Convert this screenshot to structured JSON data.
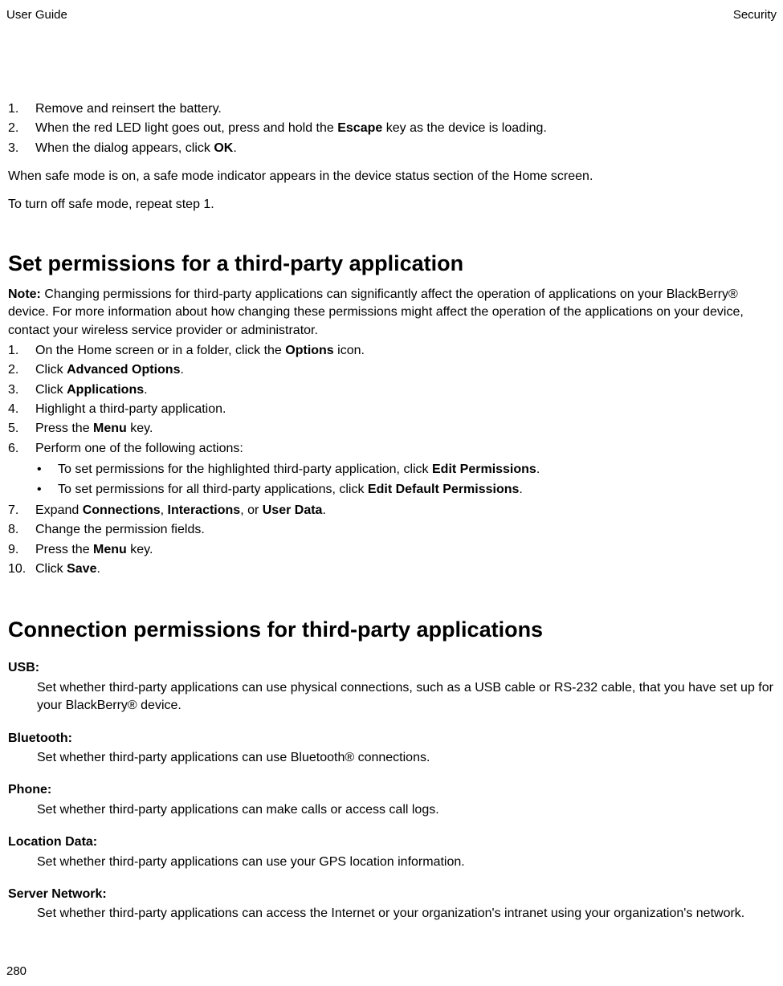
{
  "header": {
    "left": "User Guide",
    "right": "Security"
  },
  "intro_steps": [
    {
      "n": "1.",
      "parts": [
        "Remove and reinsert the battery."
      ]
    },
    {
      "n": "2.",
      "parts": [
        "When the red LED light goes out, press and hold the ",
        {
          "b": "Escape"
        },
        " key as the device is loading."
      ]
    },
    {
      "n": "3.",
      "parts": [
        "When the dialog appears, click ",
        {
          "b": "OK"
        },
        "."
      ]
    }
  ],
  "safe_mode_note": "When safe mode is on, a safe mode indicator appears in the device status section of the Home screen.",
  "turn_off_note": "To turn off safe mode, repeat step 1.",
  "section1": {
    "title": "Set permissions for a third-party application",
    "note_label": "Note:",
    "note_text": "  Changing permissions for third-party applications can significantly affect the operation of applications on your BlackBerry® device. For more information about how changing these permissions might affect the operation of the applications on your device, contact your wireless service provider or administrator.",
    "steps": [
      {
        "n": "1.",
        "parts": [
          "On the Home screen or in a folder, click the ",
          {
            "b": "Options"
          },
          " icon."
        ]
      },
      {
        "n": "2.",
        "parts": [
          "Click ",
          {
            "b": "Advanced Options"
          },
          "."
        ]
      },
      {
        "n": "3.",
        "parts": [
          "Click ",
          {
            "b": "Applications"
          },
          "."
        ]
      },
      {
        "n": "4.",
        "parts": [
          "Highlight a third-party application."
        ]
      },
      {
        "n": "5.",
        "parts": [
          "Press the ",
          {
            "b": "Menu"
          },
          " key."
        ]
      },
      {
        "n": "6.",
        "parts": [
          "Perform one of the following actions:"
        ],
        "sub": [
          {
            "parts": [
              "To set permissions for the highlighted third-party application, click ",
              {
                "b": "Edit Permissions"
              },
              "."
            ]
          },
          {
            "parts": [
              "To set permissions for all third-party applications, click ",
              {
                "b": "Edit Default Permissions"
              },
              "."
            ]
          }
        ]
      },
      {
        "n": "7.",
        "parts": [
          "Expand ",
          {
            "b": "Connections"
          },
          ", ",
          {
            "b": "Interactions"
          },
          ", or ",
          {
            "b": "User Data"
          },
          "."
        ]
      },
      {
        "n": "8.",
        "parts": [
          "Change the permission fields."
        ]
      },
      {
        "n": "9.",
        "parts": [
          "Press the ",
          {
            "b": "Menu"
          },
          " key."
        ]
      },
      {
        "n": "10.",
        "parts": [
          "Click ",
          {
            "b": "Save"
          },
          "."
        ]
      }
    ]
  },
  "section2": {
    "title": "Connection permissions for third-party applications",
    "definitions": [
      {
        "term": "USB:",
        "desc": "Set whether third-party applications can use physical connections, such as a USB cable or RS-232 cable, that you have set up for your BlackBerry® device."
      },
      {
        "term": "Bluetooth:",
        "desc": "Set whether third-party applications can use Bluetooth® connections."
      },
      {
        "term": "Phone:",
        "desc": "Set whether third-party applications can make calls or access call logs."
      },
      {
        "term": "Location Data:",
        "desc": "Set whether third-party applications can use your GPS location information."
      },
      {
        "term": "Server Network:",
        "desc": "Set whether third-party applications can access the Internet or your organization's intranet using your organization's network."
      }
    ]
  },
  "page_number": "280"
}
